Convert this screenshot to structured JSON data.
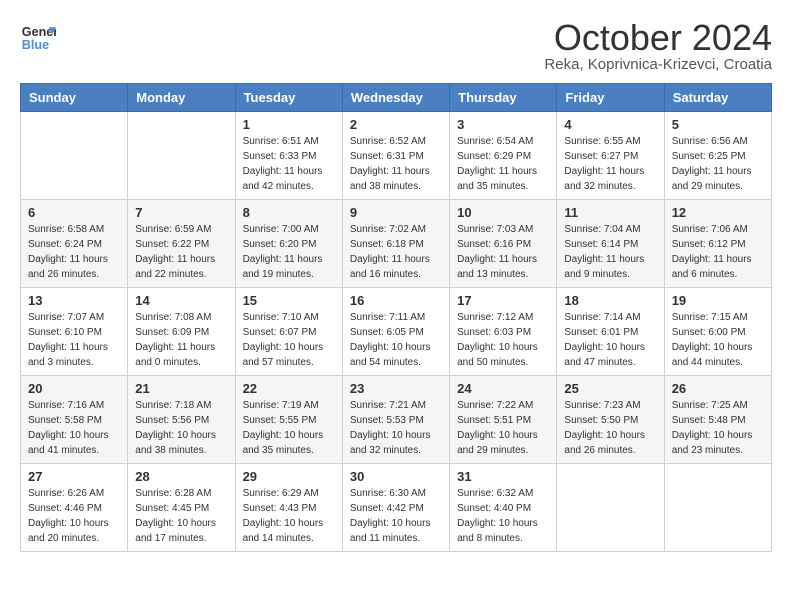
{
  "header": {
    "logo_line1": "General",
    "logo_line2": "Blue",
    "month": "October 2024",
    "location": "Reka, Koprivnica-Krizevci, Croatia"
  },
  "days_of_week": [
    "Sunday",
    "Monday",
    "Tuesday",
    "Wednesday",
    "Thursday",
    "Friday",
    "Saturday"
  ],
  "weeks": [
    [
      {
        "day": "",
        "sunrise": "",
        "sunset": "",
        "daylight": ""
      },
      {
        "day": "",
        "sunrise": "",
        "sunset": "",
        "daylight": ""
      },
      {
        "day": "1",
        "sunrise": "Sunrise: 6:51 AM",
        "sunset": "Sunset: 6:33 PM",
        "daylight": "Daylight: 11 hours and 42 minutes."
      },
      {
        "day": "2",
        "sunrise": "Sunrise: 6:52 AM",
        "sunset": "Sunset: 6:31 PM",
        "daylight": "Daylight: 11 hours and 38 minutes."
      },
      {
        "day": "3",
        "sunrise": "Sunrise: 6:54 AM",
        "sunset": "Sunset: 6:29 PM",
        "daylight": "Daylight: 11 hours and 35 minutes."
      },
      {
        "day": "4",
        "sunrise": "Sunrise: 6:55 AM",
        "sunset": "Sunset: 6:27 PM",
        "daylight": "Daylight: 11 hours and 32 minutes."
      },
      {
        "day": "5",
        "sunrise": "Sunrise: 6:56 AM",
        "sunset": "Sunset: 6:25 PM",
        "daylight": "Daylight: 11 hours and 29 minutes."
      }
    ],
    [
      {
        "day": "6",
        "sunrise": "Sunrise: 6:58 AM",
        "sunset": "Sunset: 6:24 PM",
        "daylight": "Daylight: 11 hours and 26 minutes."
      },
      {
        "day": "7",
        "sunrise": "Sunrise: 6:59 AM",
        "sunset": "Sunset: 6:22 PM",
        "daylight": "Daylight: 11 hours and 22 minutes."
      },
      {
        "day": "8",
        "sunrise": "Sunrise: 7:00 AM",
        "sunset": "Sunset: 6:20 PM",
        "daylight": "Daylight: 11 hours and 19 minutes."
      },
      {
        "day": "9",
        "sunrise": "Sunrise: 7:02 AM",
        "sunset": "Sunset: 6:18 PM",
        "daylight": "Daylight: 11 hours and 16 minutes."
      },
      {
        "day": "10",
        "sunrise": "Sunrise: 7:03 AM",
        "sunset": "Sunset: 6:16 PM",
        "daylight": "Daylight: 11 hours and 13 minutes."
      },
      {
        "day": "11",
        "sunrise": "Sunrise: 7:04 AM",
        "sunset": "Sunset: 6:14 PM",
        "daylight": "Daylight: 11 hours and 9 minutes."
      },
      {
        "day": "12",
        "sunrise": "Sunrise: 7:06 AM",
        "sunset": "Sunset: 6:12 PM",
        "daylight": "Daylight: 11 hours and 6 minutes."
      }
    ],
    [
      {
        "day": "13",
        "sunrise": "Sunrise: 7:07 AM",
        "sunset": "Sunset: 6:10 PM",
        "daylight": "Daylight: 11 hours and 3 minutes."
      },
      {
        "day": "14",
        "sunrise": "Sunrise: 7:08 AM",
        "sunset": "Sunset: 6:09 PM",
        "daylight": "Daylight: 11 hours and 0 minutes."
      },
      {
        "day": "15",
        "sunrise": "Sunrise: 7:10 AM",
        "sunset": "Sunset: 6:07 PM",
        "daylight": "Daylight: 10 hours and 57 minutes."
      },
      {
        "day": "16",
        "sunrise": "Sunrise: 7:11 AM",
        "sunset": "Sunset: 6:05 PM",
        "daylight": "Daylight: 10 hours and 54 minutes."
      },
      {
        "day": "17",
        "sunrise": "Sunrise: 7:12 AM",
        "sunset": "Sunset: 6:03 PM",
        "daylight": "Daylight: 10 hours and 50 minutes."
      },
      {
        "day": "18",
        "sunrise": "Sunrise: 7:14 AM",
        "sunset": "Sunset: 6:01 PM",
        "daylight": "Daylight: 10 hours and 47 minutes."
      },
      {
        "day": "19",
        "sunrise": "Sunrise: 7:15 AM",
        "sunset": "Sunset: 6:00 PM",
        "daylight": "Daylight: 10 hours and 44 minutes."
      }
    ],
    [
      {
        "day": "20",
        "sunrise": "Sunrise: 7:16 AM",
        "sunset": "Sunset: 5:58 PM",
        "daylight": "Daylight: 10 hours and 41 minutes."
      },
      {
        "day": "21",
        "sunrise": "Sunrise: 7:18 AM",
        "sunset": "Sunset: 5:56 PM",
        "daylight": "Daylight: 10 hours and 38 minutes."
      },
      {
        "day": "22",
        "sunrise": "Sunrise: 7:19 AM",
        "sunset": "Sunset: 5:55 PM",
        "daylight": "Daylight: 10 hours and 35 minutes."
      },
      {
        "day": "23",
        "sunrise": "Sunrise: 7:21 AM",
        "sunset": "Sunset: 5:53 PM",
        "daylight": "Daylight: 10 hours and 32 minutes."
      },
      {
        "day": "24",
        "sunrise": "Sunrise: 7:22 AM",
        "sunset": "Sunset: 5:51 PM",
        "daylight": "Daylight: 10 hours and 29 minutes."
      },
      {
        "day": "25",
        "sunrise": "Sunrise: 7:23 AM",
        "sunset": "Sunset: 5:50 PM",
        "daylight": "Daylight: 10 hours and 26 minutes."
      },
      {
        "day": "26",
        "sunrise": "Sunrise: 7:25 AM",
        "sunset": "Sunset: 5:48 PM",
        "daylight": "Daylight: 10 hours and 23 minutes."
      }
    ],
    [
      {
        "day": "27",
        "sunrise": "Sunrise: 6:26 AM",
        "sunset": "Sunset: 4:46 PM",
        "daylight": "Daylight: 10 hours and 20 minutes."
      },
      {
        "day": "28",
        "sunrise": "Sunrise: 6:28 AM",
        "sunset": "Sunset: 4:45 PM",
        "daylight": "Daylight: 10 hours and 17 minutes."
      },
      {
        "day": "29",
        "sunrise": "Sunrise: 6:29 AM",
        "sunset": "Sunset: 4:43 PM",
        "daylight": "Daylight: 10 hours and 14 minutes."
      },
      {
        "day": "30",
        "sunrise": "Sunrise: 6:30 AM",
        "sunset": "Sunset: 4:42 PM",
        "daylight": "Daylight: 10 hours and 11 minutes."
      },
      {
        "day": "31",
        "sunrise": "Sunrise: 6:32 AM",
        "sunset": "Sunset: 4:40 PM",
        "daylight": "Daylight: 10 hours and 8 minutes."
      },
      {
        "day": "",
        "sunrise": "",
        "sunset": "",
        "daylight": ""
      },
      {
        "day": "",
        "sunrise": "",
        "sunset": "",
        "daylight": ""
      }
    ]
  ]
}
